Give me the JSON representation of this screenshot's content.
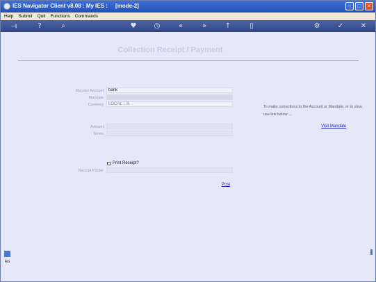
{
  "window": {
    "title": "IES Navigator Client v8.08 : My IES :     [mode-2]"
  },
  "menu": [
    "Help",
    "Submit",
    "Quit",
    "Functions",
    "Commands"
  ],
  "toolbar_icons": [
    "logout-icon",
    "help-icon",
    "search-icon",
    "favourite-icon",
    "history-icon",
    "back-icon",
    "forward-icon",
    "up-icon",
    "page-icon",
    "settings-icon",
    "confirm-icon",
    "cancel-icon"
  ],
  "page": {
    "title": "Collection Receipt / Payment"
  },
  "form": {
    "receipt_account_label": "Receipt Account",
    "receipt_account_value": "bank",
    "mandate_label": "Mandate",
    "mandate_value": "",
    "currency_label": "Currency",
    "currency_value": "LOCAL :: R",
    "amount_label": "Amount",
    "amount_value": "",
    "terms_label": "Terms",
    "terms_value": "",
    "print_receipt_label": "Print Receipt?",
    "receipt_printer_label": "Receipt Printer",
    "receipt_printer_value": "",
    "post_label": "Post"
  },
  "help": {
    "text": "To make corrections to the Account or Mandate, or to view, use link below ...",
    "visit_mandate_label": "Visit Mandate"
  }
}
